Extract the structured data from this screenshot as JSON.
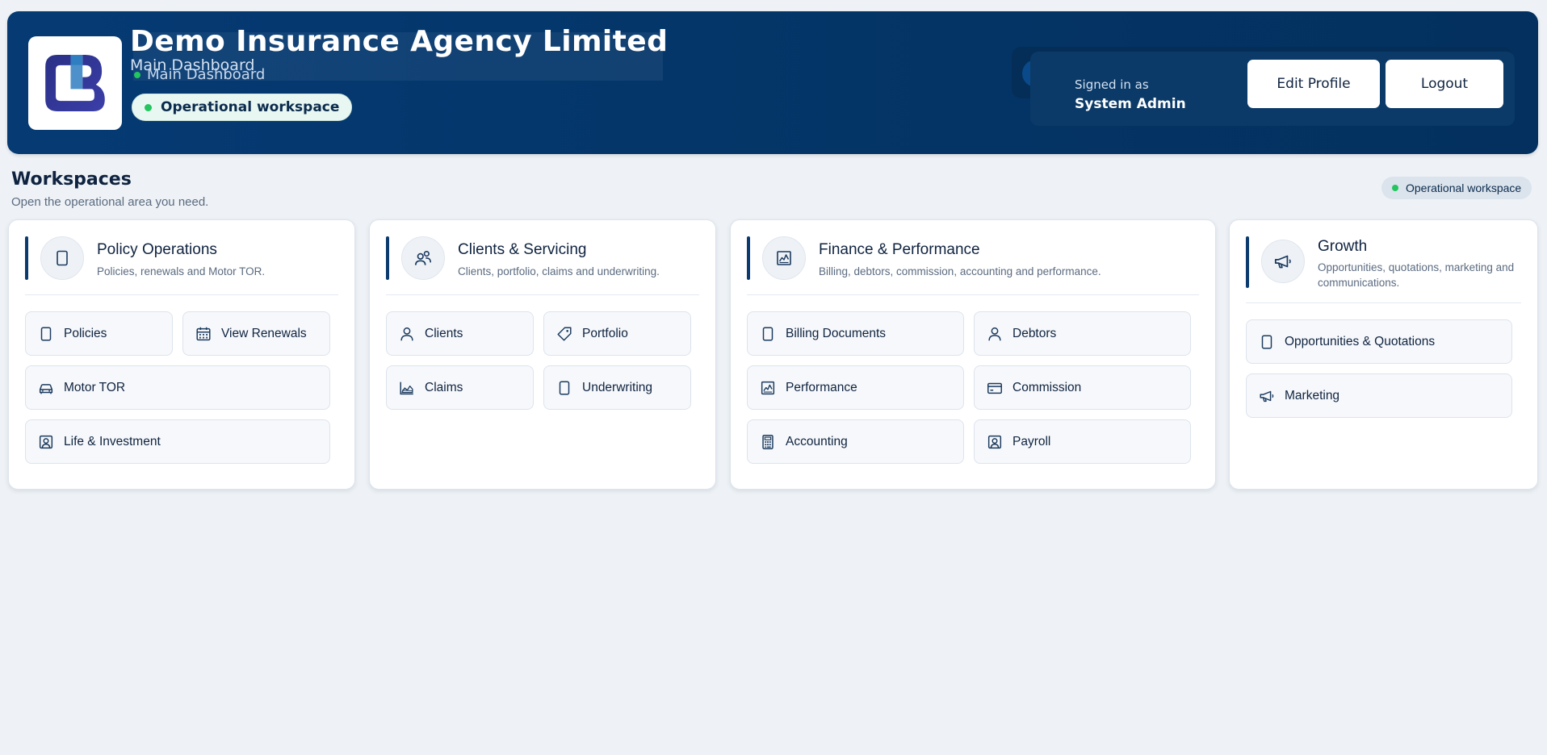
{
  "header": {
    "agency_name": "Demo Insurance Agency Limited",
    "subtitle": "Main Dashboard",
    "subtitle_overlay": "Main Dashboard",
    "status_pill": "Operational workspace",
    "signed_in_label": "Signed in as",
    "user_name": "System Admin",
    "edit_profile_label": "Edit Profile",
    "logout_label": "Logout"
  },
  "workspaces": {
    "title": "Workspaces",
    "subtitle": "Open the operational area you need.",
    "status_pill": "Operational workspace"
  },
  "cards": [
    {
      "title": "Policy Operations",
      "description": "Policies, renewals and Motor TOR.",
      "icon": "document-icon",
      "items": [
        {
          "label": "Policies",
          "icon": "document-icon"
        },
        {
          "label": "View Renewals",
          "icon": "calendar-icon"
        },
        {
          "label": "Motor TOR",
          "icon": "car-icon"
        },
        {
          "label": "Life & Investment",
          "icon": "portrait-icon"
        }
      ]
    },
    {
      "title": "Clients & Servicing",
      "description": "Clients, portfolio, claims and underwriting.",
      "icon": "users-icon",
      "items": [
        {
          "label": "Clients",
          "icon": "user-icon"
        },
        {
          "label": "Portfolio",
          "icon": "tag-icon"
        },
        {
          "label": "Claims",
          "icon": "area-chart-icon"
        },
        {
          "label": "Underwriting",
          "icon": "document-icon"
        }
      ]
    },
    {
      "title": "Finance & Performance",
      "description": "Billing, debtors, commission, accounting and performance.",
      "icon": "chart-icon",
      "items": [
        {
          "label": "Billing Documents",
          "icon": "document-icon"
        },
        {
          "label": "Debtors",
          "icon": "user-icon"
        },
        {
          "label": "Performance",
          "icon": "chart-icon"
        },
        {
          "label": "Commission",
          "icon": "credit-card-icon"
        },
        {
          "label": "Accounting",
          "icon": "calculator-icon"
        },
        {
          "label": "Payroll",
          "icon": "portrait-icon"
        }
      ]
    },
    {
      "title": "Growth",
      "description": "Opportunities, quotations, marketing and communications.",
      "icon": "megaphone-icon",
      "items": [
        {
          "label": "Opportunities & Quotations",
          "icon": "document-icon"
        },
        {
          "label": "Marketing",
          "icon": "megaphone-icon"
        }
      ]
    }
  ],
  "colors": {
    "header_bg": "#053a73",
    "accent_bar": "#0b3a6e",
    "status_dot": "#22c55e",
    "page_bg": "#eef2f6"
  }
}
